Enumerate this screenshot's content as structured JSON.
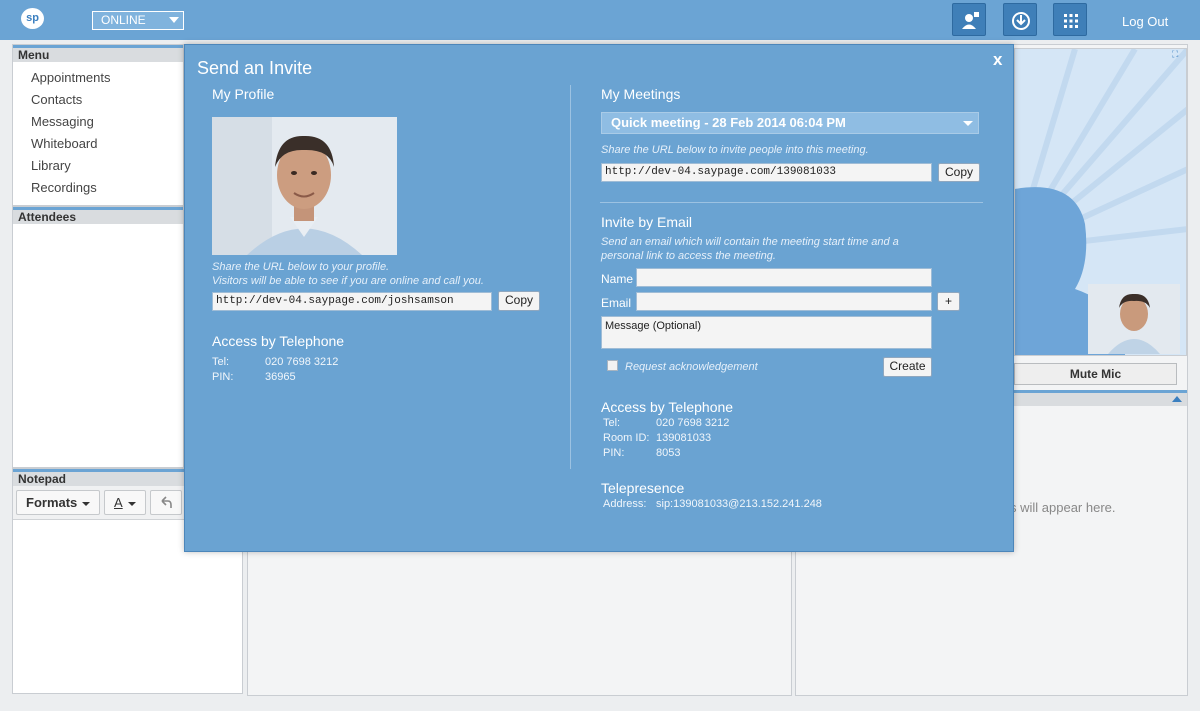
{
  "topbar": {
    "logo_text": "sp",
    "status_value": "ONLINE",
    "logout_label": "Log Out",
    "accent_color": "#6ba4d4"
  },
  "menu": {
    "title": "Menu",
    "items": [
      "Appointments",
      "Contacts",
      "Messaging",
      "Whiteboard",
      "Library",
      "Recordings"
    ]
  },
  "attendees": {
    "title": "Attendees"
  },
  "notepad": {
    "title": "Notepad",
    "formats_label": "Formats",
    "font_color_label": "A"
  },
  "right_panel": {
    "mute_label": "Mute Mic",
    "placeholder_text": "s will appear here."
  },
  "modal": {
    "title": "Send an Invite",
    "close_label": "x",
    "profile": {
      "heading": "My Profile",
      "hint_line1": "Share the URL below to your profile.",
      "hint_line2": "Visitors will be able to see if you are online and call you.",
      "url": "http://dev-04.saypage.com/joshsamson",
      "copy_label": "Copy"
    },
    "profile_phone": {
      "heading": "Access by Telephone",
      "tel_label": "Tel:",
      "tel_value": "020 7698 3212",
      "pin_label": "PIN:",
      "pin_value": "36965"
    },
    "meetings": {
      "heading": "My Meetings",
      "selected_meeting": "Quick meeting - 28 Feb 2014 06:04 PM",
      "hint": "Share the URL below to invite people into this meeting.",
      "url": "http://dev-04.saypage.com/139081033",
      "copy_label": "Copy"
    },
    "invite": {
      "heading": "Invite by Email",
      "hint_line1": "Send an email which will contain the meeting start time and a",
      "hint_line2": "personal link to access the meeting.",
      "name_label": "Name",
      "email_label": "Email",
      "add_label": "+",
      "message_placeholder": "Message (Optional)",
      "ack_label": "Request acknowledgement",
      "create_label": "Create"
    },
    "meeting_phone": {
      "heading": "Access by Telephone",
      "tel_label": "Tel:",
      "tel_value": "020 7698 3212",
      "room_label": "Room ID:",
      "room_value": "139081033",
      "pin_label": "PIN:",
      "pin_value": "8053"
    },
    "telepresence": {
      "heading": "Telepresence",
      "address_label": "Address:",
      "address_value": "sip:139081033@213.152.241.248"
    }
  }
}
